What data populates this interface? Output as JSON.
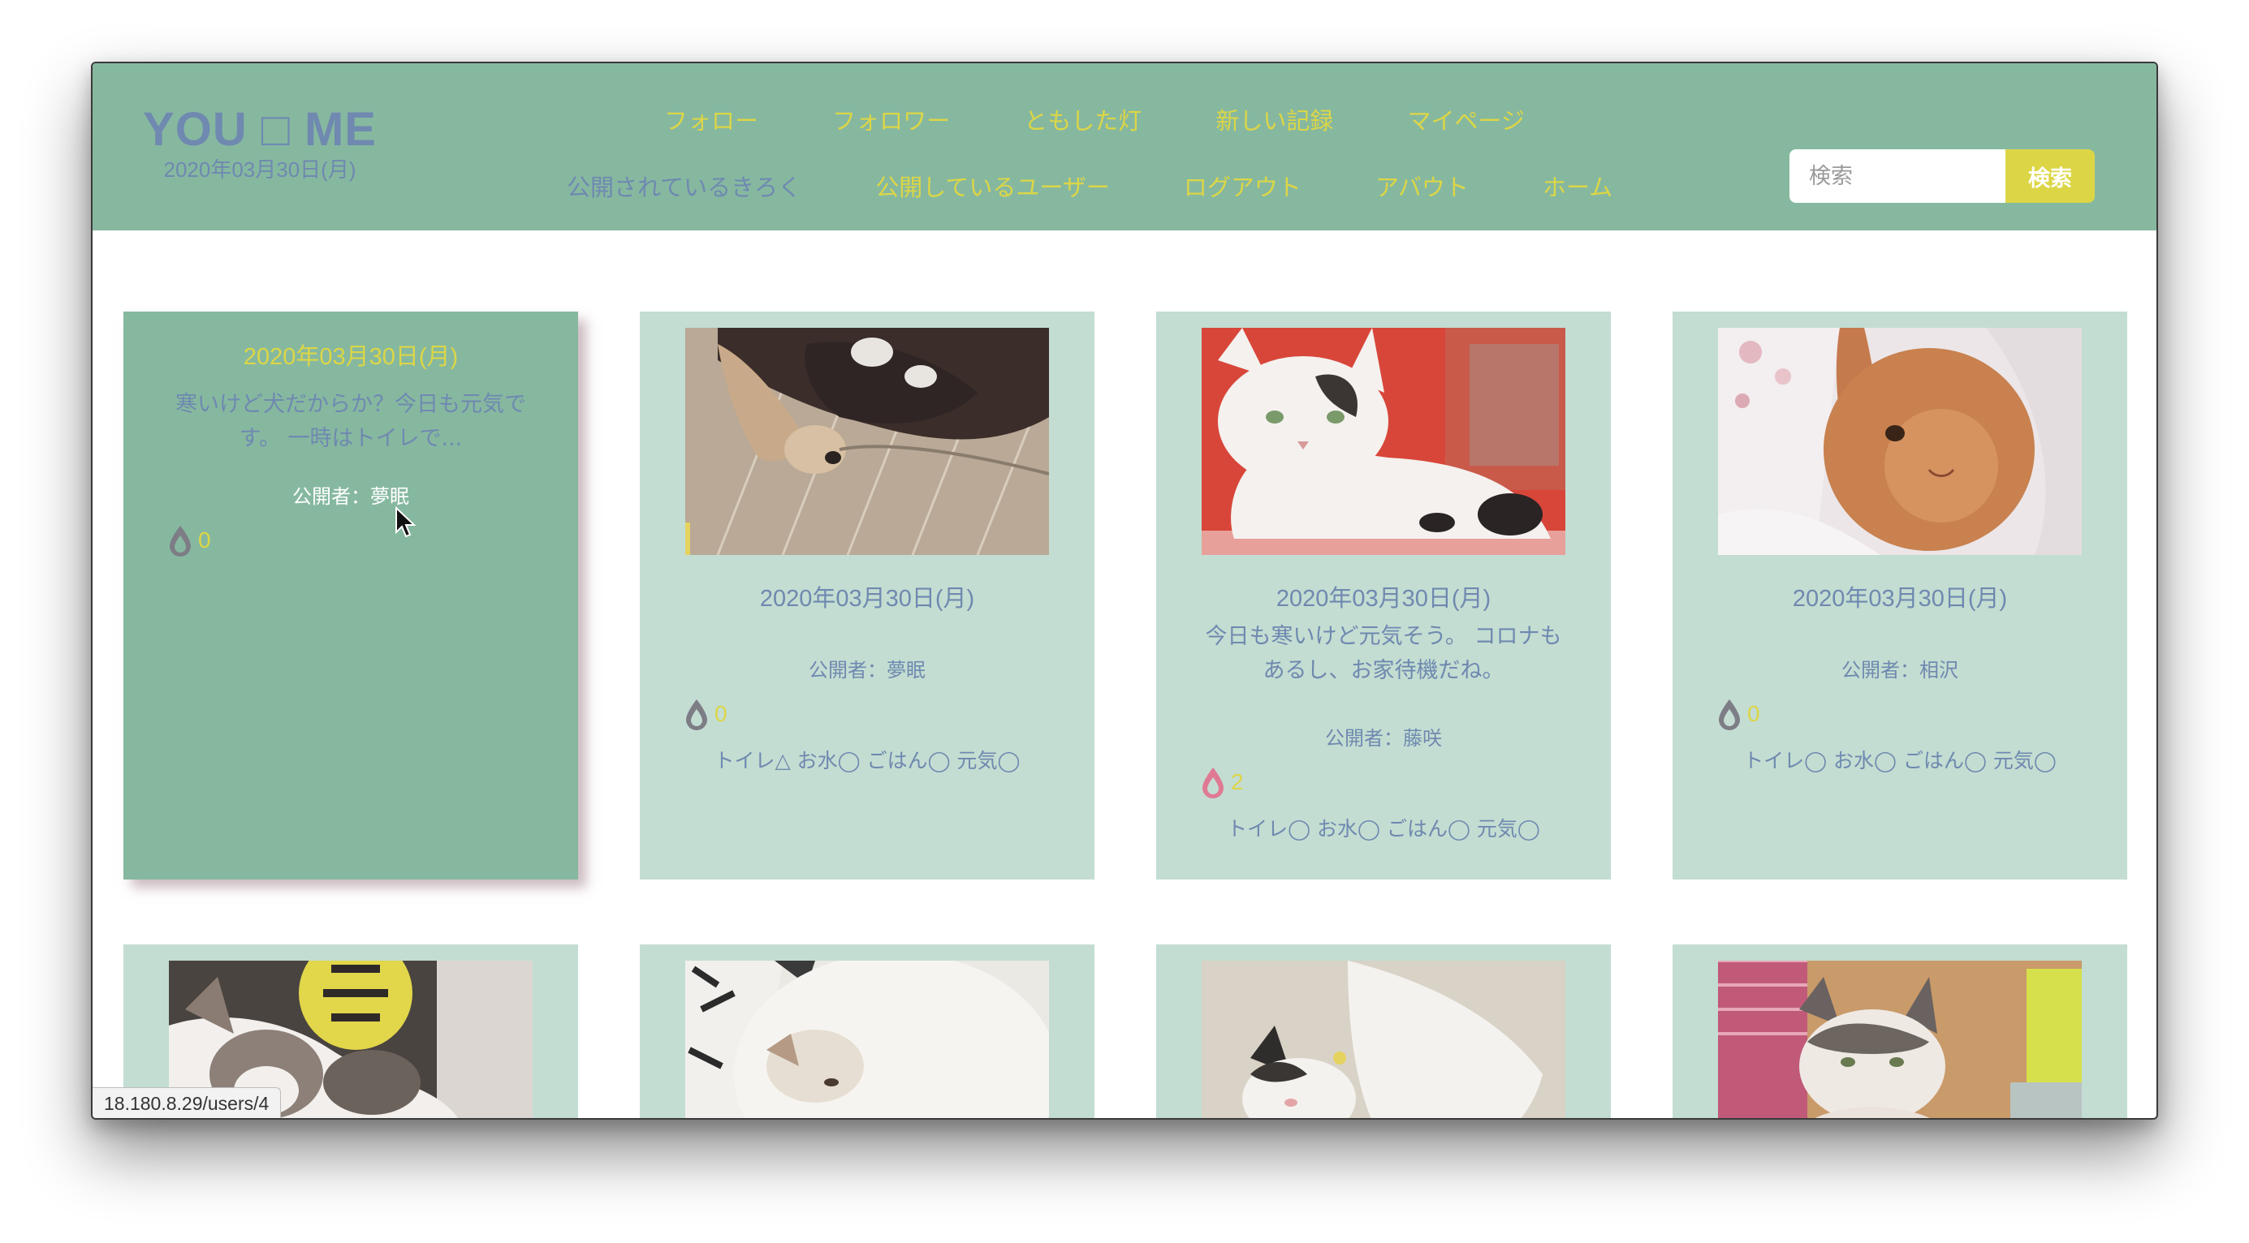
{
  "header": {
    "brand_title": "YOU □ ME",
    "brand_date": "2020年03月30日(月)",
    "nav_row1": [
      "フォロー",
      "フォロワー",
      "ともした灯",
      "新しい記録",
      "マイページ"
    ],
    "nav_row2": [
      "公開されているきろく",
      "公開しているユーザー",
      "ログアウト",
      "アバウト",
      "ホーム"
    ],
    "search_placeholder": "検索",
    "search_button": "検索"
  },
  "colors": {
    "header_bg": "#86b8a0",
    "card_bg": "#c3ddd2",
    "accent_yellow": "#dcd646",
    "text_blue": "#6f89b0",
    "like_active": "#e07a94",
    "like_inactive": "#7d7d86"
  },
  "cards": [
    {
      "date": "2020年03月30日(月)",
      "body": "寒いけど犬だからか？今日も元気です。 一時はトイレで...",
      "author": "公開者：夢眠",
      "likes": "0",
      "like_icon": "drop-icon",
      "status": ""
    },
    {
      "date": "2020年03月30日(月)",
      "body": "",
      "author": "公開者：夢眠",
      "likes": "0",
      "like_icon": "drop-icon",
      "status": "トイレ△ お水◯ ごはん◯ 元気◯"
    },
    {
      "date": "2020年03月30日(月)",
      "body": "今日も寒いけど元気そう。 コロナもあるし、お家待機だね。",
      "author": "公開者：藤咲",
      "likes": "2",
      "like_icon": "drop-icon",
      "status": "トイレ◯ お水◯ ごはん◯ 元気◯"
    },
    {
      "date": "2020年03月30日(月)",
      "body": "",
      "author": "公開者：相沢",
      "likes": "0",
      "like_icon": "drop-icon",
      "status": "トイレ◯ お水◯ ごはん◯ 元気◯"
    }
  ],
  "status_bar_url": "18.180.8.29/users/4"
}
